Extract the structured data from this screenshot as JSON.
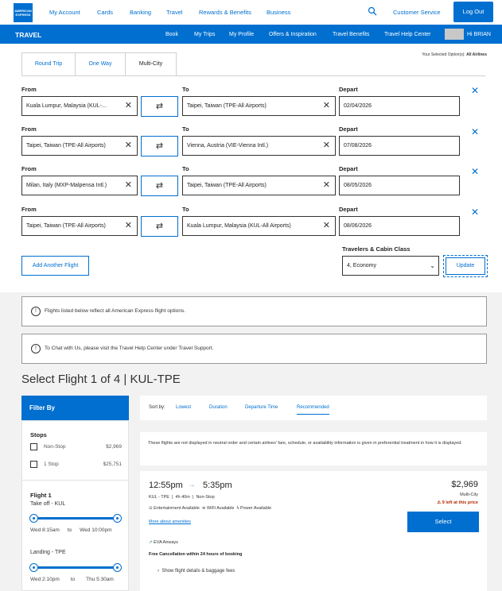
{
  "header": {
    "logo_text": "AMERICAN EXPRESS",
    "nav": [
      "My Account",
      "Cards",
      "Banking",
      "Travel",
      "Rewards & Benefits",
      "Business"
    ],
    "customer_service": "Customer Service",
    "logout": "Log Out"
  },
  "travelbar": {
    "title": "TRAVEL",
    "nav": [
      "Book",
      "My Trips",
      "My Profile",
      "Offers & Inspiration",
      "Travel Benefits",
      "Travel Help Center"
    ],
    "greeting": "Hi BRIAN"
  },
  "search": {
    "tabs": [
      "Round Trip",
      "One Way",
      "Multi-City"
    ],
    "selected_options_label": "Your Selected Option(s):",
    "selected_options_value": "All Airlines",
    "labels": {
      "from": "From",
      "to": "To",
      "depart": "Depart"
    },
    "flights": [
      {
        "from": "Kuala Lumpur, Malaysia (KUL-...",
        "to": "Taipei, Taiwan (TPE-All Airports)",
        "depart": "02/04/2026"
      },
      {
        "from": "Taipei, Taiwan (TPE-All Airports)",
        "to": "Vienna, Austria (VIE-Vienna Intl.)",
        "depart": "07/08/2026"
      },
      {
        "from": "Milan, Italy (MXP-Malpensa Intl.)",
        "to": "Taipei, Taiwan (TPE-All Airports)",
        "depart": "08/05/2026"
      },
      {
        "from": "Taipei, Taiwan (TPE-All Airports)",
        "to": "Kuala Lumpur, Malaysia (KUL-All Airports)",
        "depart": "08/06/2026"
      }
    ],
    "add_flight": "Add Another Flight",
    "travelers_label": "Travelers & Cabin Class",
    "travelers_value": "4, Economy",
    "update": "Update"
  },
  "notices": [
    "Flights listed below reflect all American Express flight options.",
    "To Chat with Us, please visit the Travel Help Center under Travel Support."
  ],
  "results": {
    "heading": "Select Flight 1 of 4 | KUL-TPE",
    "filter": {
      "title": "Filter By",
      "stops_title": "Stops",
      "stops": [
        {
          "label": "Non-Stop",
          "price": "$2,969"
        },
        {
          "label": "1 Stop",
          "price": "$25,751"
        }
      ],
      "flight_title": "Flight 1",
      "takeoff_label": "Take off - KUL",
      "takeoff_range": [
        "Wed 8:15am",
        "to",
        "Wed 10:00pm"
      ],
      "landing_label": "Landing - TPE",
      "landing_range": [
        "Wed 2:10pm",
        "to",
        "Thu 5:30am"
      ]
    },
    "sort": {
      "label": "Sort by:",
      "options": [
        "Lowest",
        "Duration",
        "Departure Time",
        "Recommended"
      ],
      "active": "Recommended"
    },
    "disclaimer": "These flights are not displayed in neutral order and certain airlines' fare, schedule, or availability information is given in preferential treatment in how it is displayed.",
    "flight": {
      "depart_time": "12:55pm",
      "arrive_time": "5:35pm",
      "route": "KUL - TPE",
      "duration": "4h 40m",
      "stops": "Non-Stop",
      "amenities": [
        "Entertainment Available",
        "WiFi Available",
        "Power Available"
      ],
      "more_amenities": "More about amenities",
      "price": "$2,969",
      "price_type": "Multi-City",
      "seats_left": "9 left at this price",
      "select": "Select",
      "airline": "EVA Airways",
      "free_cancel": "Free Cancellation within 24 hours of booking",
      "details": "Show flight details & baggage fees"
    }
  }
}
